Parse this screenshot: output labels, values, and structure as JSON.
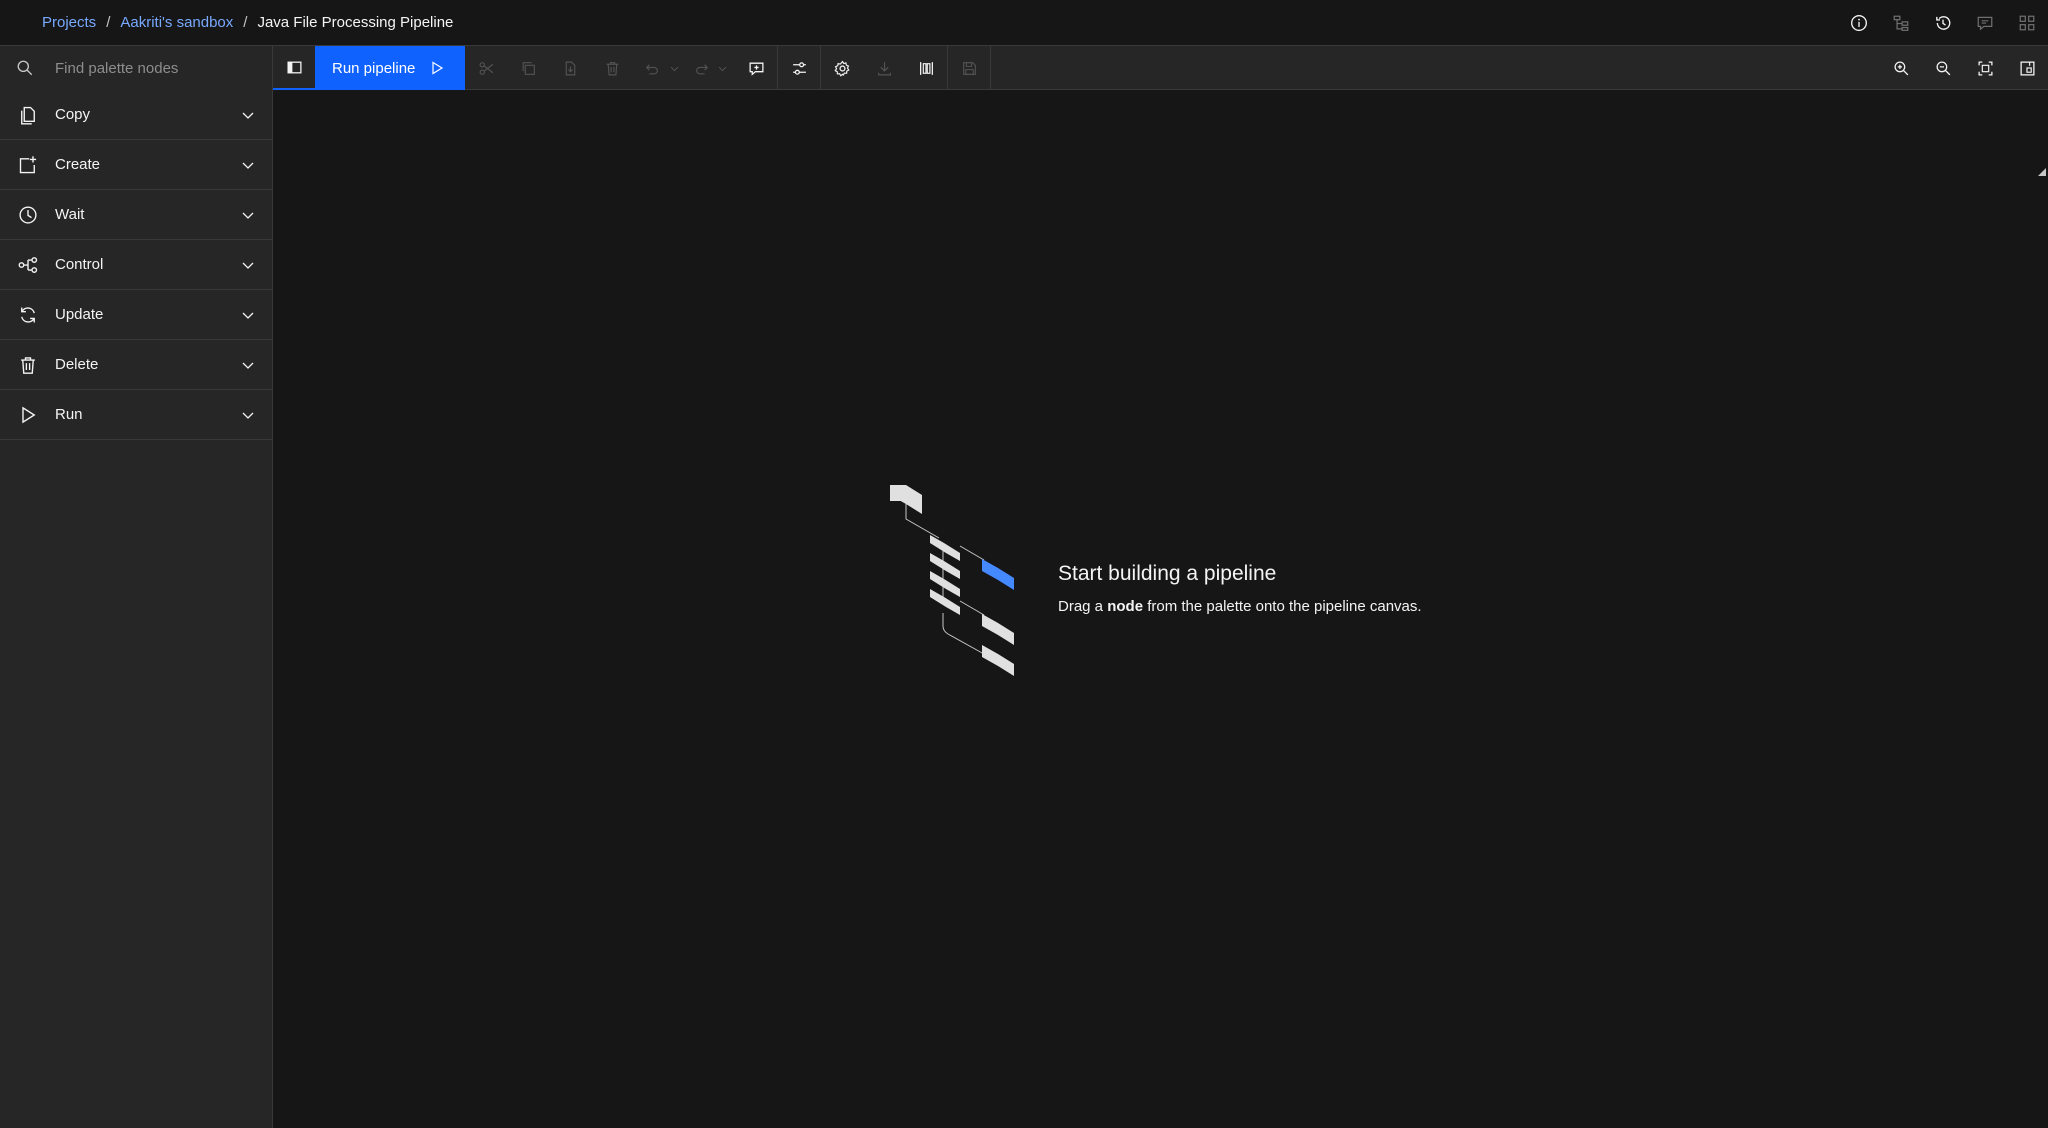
{
  "breadcrumb": {
    "projects": "Projects",
    "sandbox": "Aakriti's sandbox",
    "current": "Java File Processing Pipeline",
    "separator": "/"
  },
  "search": {
    "placeholder": "Find palette nodes"
  },
  "toolbar": {
    "run_label": "Run pipeline"
  },
  "palette": {
    "items": [
      {
        "label": "Copy",
        "icon": "copy-icon"
      },
      {
        "label": "Create",
        "icon": "add-document-icon"
      },
      {
        "label": "Wait",
        "icon": "clock-icon"
      },
      {
        "label": "Control",
        "icon": "flow-icon"
      },
      {
        "label": "Update",
        "icon": "refresh-icon"
      },
      {
        "label": "Delete",
        "icon": "trash-icon"
      },
      {
        "label": "Run",
        "icon": "play-icon"
      }
    ]
  },
  "empty_state": {
    "title": "Start building a pipeline",
    "desc_pre": "Drag a ",
    "desc_bold": "node",
    "desc_post": " from the palette onto the pipeline canvas."
  },
  "colors": {
    "accent": "#0f62fe",
    "link": "#78a9ff",
    "background": "#161616",
    "panel": "#262626"
  }
}
